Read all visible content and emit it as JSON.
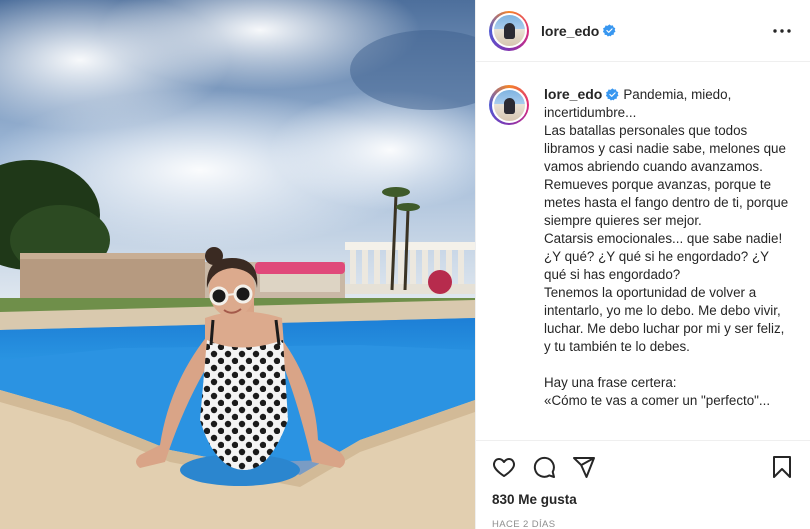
{
  "post": {
    "username": "lore_edo",
    "verified": true,
    "caption_username": "lore_edo",
    "caption_text": "Pandemia, miedo, incertidumbre...\nLas batallas personales que todos libramos y casi nadie sabe, melones que vamos abriendo cuando avanzamos. Remueves porque avanzas, porque te metes hasta el fango dentro de ti, porque siempre quieres ser mejor.\nCatarsis emocionales... que sabe nadie!\n¿Y qué? ¿Y qué si he engordado? ¿Y qué si has engordado?\nTenemos la oportunidad de volver a intentarlo, yo me lo debo. Me debo vivir, luchar. Me debo luchar por mi y ser feliz, y tu también te lo debes.\n\nHay una frase certera:\n«Cómo te vas a comer un \"perfecto\"...",
    "likes": "830 Me gusta",
    "time": "HACE 2 DÍAS"
  },
  "icons": {
    "more": "more-options-icon",
    "like": "heart-icon",
    "comment": "comment-icon",
    "share": "paper-plane-icon",
    "save": "bookmark-icon",
    "verified": "verified-badge-icon"
  },
  "colors": {
    "verified_blue": "#3897f0",
    "text": "#262626",
    "muted": "#8e8e8e",
    "border": "#efefef"
  }
}
